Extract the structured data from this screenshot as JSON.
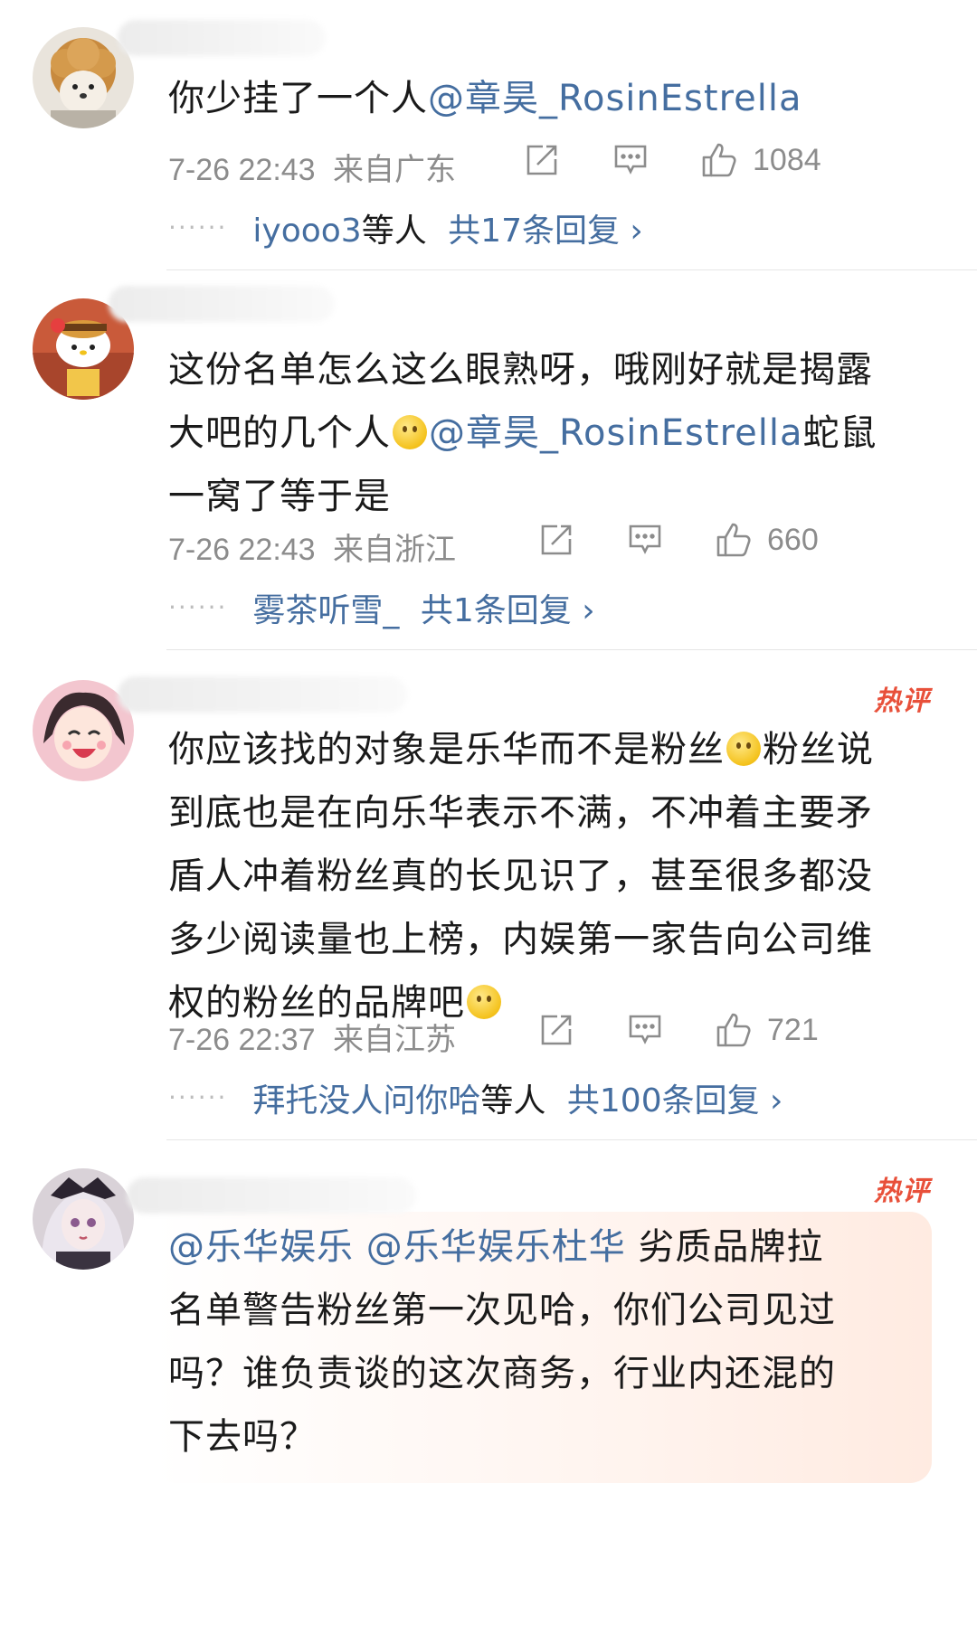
{
  "comments": [
    {
      "text_plain": "你少挂了一个人",
      "mention": "@章昊_RosinEstrella",
      "time": "7-26 22:43",
      "location": "来自广东",
      "likes": "1084",
      "reply_users": "iyooo3",
      "reply_suffix": "等人",
      "reply_count": "共17条回复 ›"
    },
    {
      "text_1": "这份名单怎么这么眼熟呀，哦刚好就是揭露",
      "text_2": "大吧的几个人",
      "mention": "@章昊_RosinEstrella",
      "text_3": "蛇鼠",
      "text_4": "一窝了等于是",
      "time": "7-26 22:43",
      "location": "来自浙江",
      "likes": "660",
      "reply_users": "雾茶听雪_",
      "reply_count": "共1条回复 ›"
    },
    {
      "badge": "热评",
      "text_1a": "你应该找的对象是乐华而不是粉丝",
      "text_1b": "粉丝说",
      "text_2": "到底也是在向乐华表示不满，不冲着主要矛",
      "text_3": "盾人冲着粉丝真的长见识了，甚至很多都没",
      "text_4": "多少阅读量也上榜，内娱第一家告向公司维",
      "text_5": "权的粉丝的品牌吧",
      "time": "7-26 22:37",
      "location": "来自江苏",
      "likes": "721",
      "reply_users": "拜托没人问你哈",
      "reply_suffix": "等人",
      "reply_count": "共100条回复 ›"
    },
    {
      "badge": "热评",
      "mention_1": "@乐华娱乐",
      "mention_2": "@乐华娱乐杜华",
      "text_1": "劣质品牌拉",
      "text_2": "名单警告粉丝第一次见哈，你们公司见过",
      "text_3": "吗？谁负责谈的这次商务，行业内还混的",
      "text_4": "下去吗？"
    }
  ]
}
